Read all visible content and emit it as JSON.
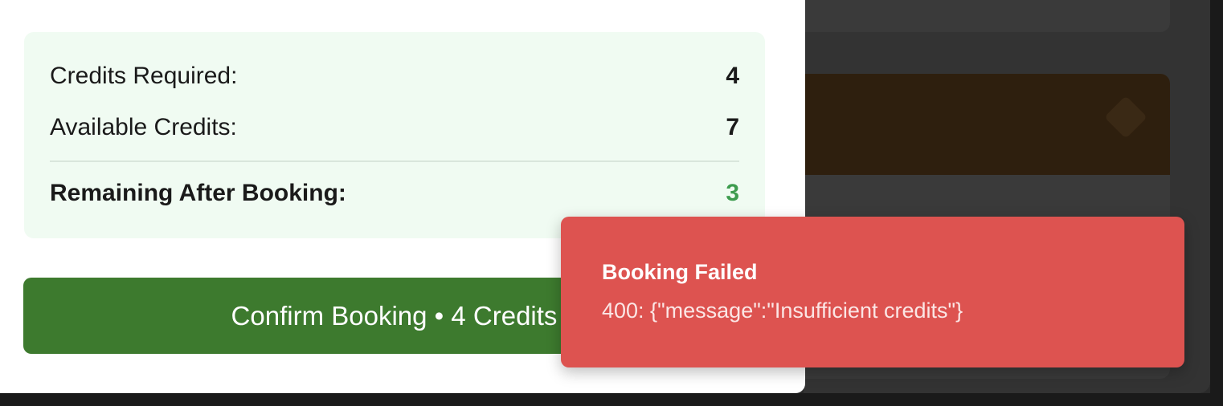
{
  "summary": {
    "credits_required_label": "Credits Required:",
    "credits_required_value": "4",
    "available_credits_label": "Available Credits:",
    "available_credits_value": "7",
    "remaining_label": "Remaining After Booking:",
    "remaining_value": "3"
  },
  "confirm_button": {
    "label": "Confirm Booking • 4 Credits"
  },
  "toast": {
    "title": "Booking Failed",
    "message": "400: {\"message\":\"Insufficient credits\"}"
  },
  "colors": {
    "accent_green": "#3d7a2e",
    "remaining_green": "#3e9c4f",
    "summary_bg": "#f0fbf2",
    "toast_bg": "#dd5350"
  }
}
